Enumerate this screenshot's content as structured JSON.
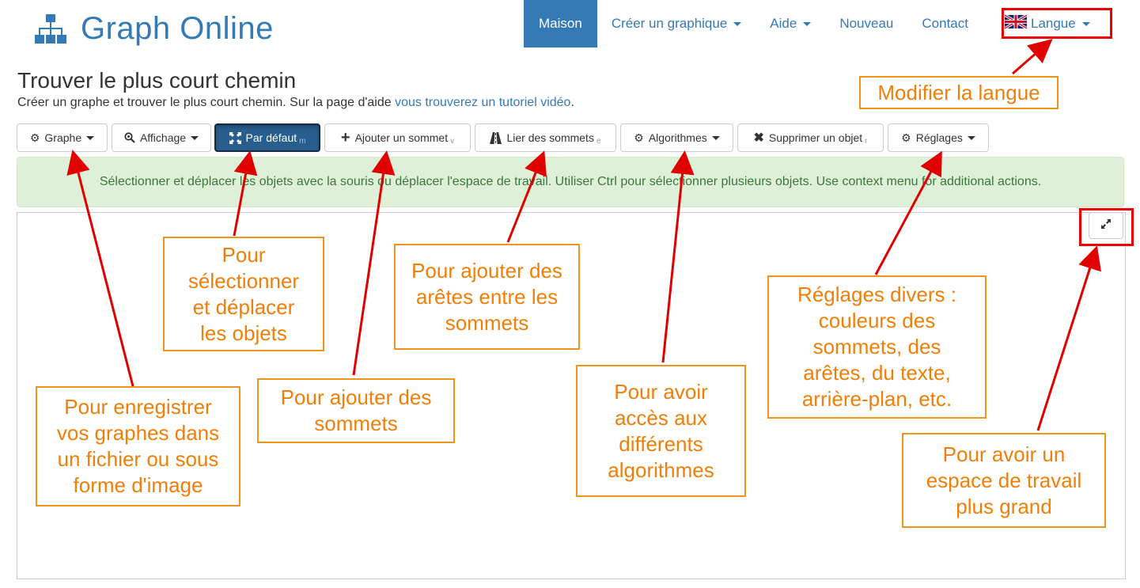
{
  "brand": {
    "title": "Graph Online",
    "icon": "sitemap-icon",
    "color": "#337ab7"
  },
  "nav": {
    "items": [
      {
        "label": "Maison",
        "active": true,
        "caret": false
      },
      {
        "label": "Créer un graphique",
        "active": false,
        "caret": true
      },
      {
        "label": "Aide",
        "active": false,
        "caret": true
      },
      {
        "label": "Nouveau",
        "active": false,
        "caret": false
      },
      {
        "label": "Contact",
        "active": false,
        "caret": false
      },
      {
        "label": "Langue",
        "active": false,
        "caret": true,
        "icon": "uk-flag-icon"
      }
    ]
  },
  "page": {
    "title": "Trouver le plus court chemin",
    "subtitle": "Créer un graphe et trouver le plus court chemin. Sur la page d'aide ",
    "subtitle_link": "vous trouverez un tutoriel vidéo",
    "subtitle_end": "."
  },
  "toolbar": {
    "graph": {
      "label": "Graphe",
      "icon": "gear-icon"
    },
    "view": {
      "label": "Affichage",
      "icon": "zoom-icon"
    },
    "default": {
      "label": "Par défaut",
      "shortcut": "m",
      "icon": "move-icon"
    },
    "add_vertex": {
      "label": "Ajouter un sommet",
      "shortcut": "v",
      "icon": "plus-icon"
    },
    "connect": {
      "label": "Lier des sommets",
      "shortcut": "e",
      "icon": "road-icon"
    },
    "algorithms": {
      "label": "Algorithmes",
      "icon": "gear-icon"
    },
    "delete": {
      "label": "Supprimer un objet",
      "shortcut": "r",
      "icon": "close-icon"
    },
    "settings": {
      "label": "Réglages",
      "icon": "gear-icon"
    }
  },
  "alert": {
    "text": "Sélectionner et déplacer les objets avec la souris ou déplacer l'espace de travail. Utiliser Ctrl pour sélectionner plusieurs objets. Use context menu for additional actions."
  },
  "canvas": {
    "fullscreen_icon": "expand-icon"
  },
  "annotations": {
    "language": "Modifier la langue",
    "select": "Pour\nsélectionner\net déplacer\nles objets",
    "edges": "Pour ajouter des\narêtes entre les\nsommets",
    "settings": "Réglages divers :\ncouleurs des\nsommets, des\narêtes, du texte,\narrière-plan, etc.",
    "save": "Pour enregistrer\nvos graphes dans\nun fichier ou sous\nforme d'image",
    "vertices": "Pour ajouter des\nsommets",
    "algorithms": "Pour avoir\naccès aux\ndifférents\nalgorithmes",
    "fullscreen": "Pour avoir un\nespace de travail\nplus grand"
  },
  "colors": {
    "accent": "#337ab7",
    "alert_bg": "#dff0d8",
    "alert_text": "#3c763d",
    "callout_border": "#f0941e",
    "callout_text": "#f07f0a",
    "arrow": "#e00000"
  }
}
